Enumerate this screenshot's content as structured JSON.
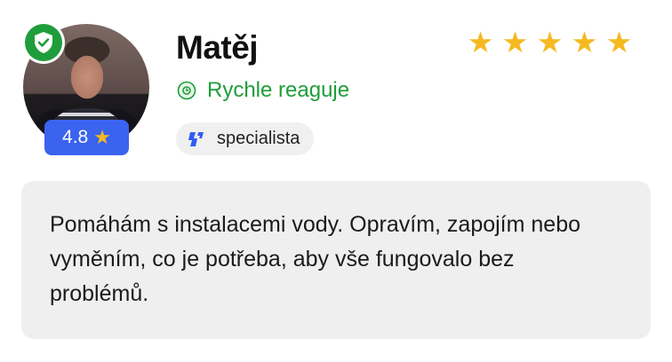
{
  "profile": {
    "name": "Matěj",
    "rating": "4.8",
    "response_label": "Rychle reaguje",
    "chip_label": "specialista",
    "stars_count": 5,
    "verified_icon": "shield-check-icon",
    "response_icon": "clock-icon",
    "chip_icon": "specialist-logo-icon"
  },
  "bio": {
    "text": "Pomáhám s instalacemi vody. Opravím, zapojím nebo vyměním, co je potřeba, aby vše fungovalo bez problémů."
  },
  "colors": {
    "accent_green": "#1f9d3a",
    "badge_blue": "#3a63f0",
    "star_yellow": "#f5b921",
    "bio_bg": "#efefef"
  }
}
